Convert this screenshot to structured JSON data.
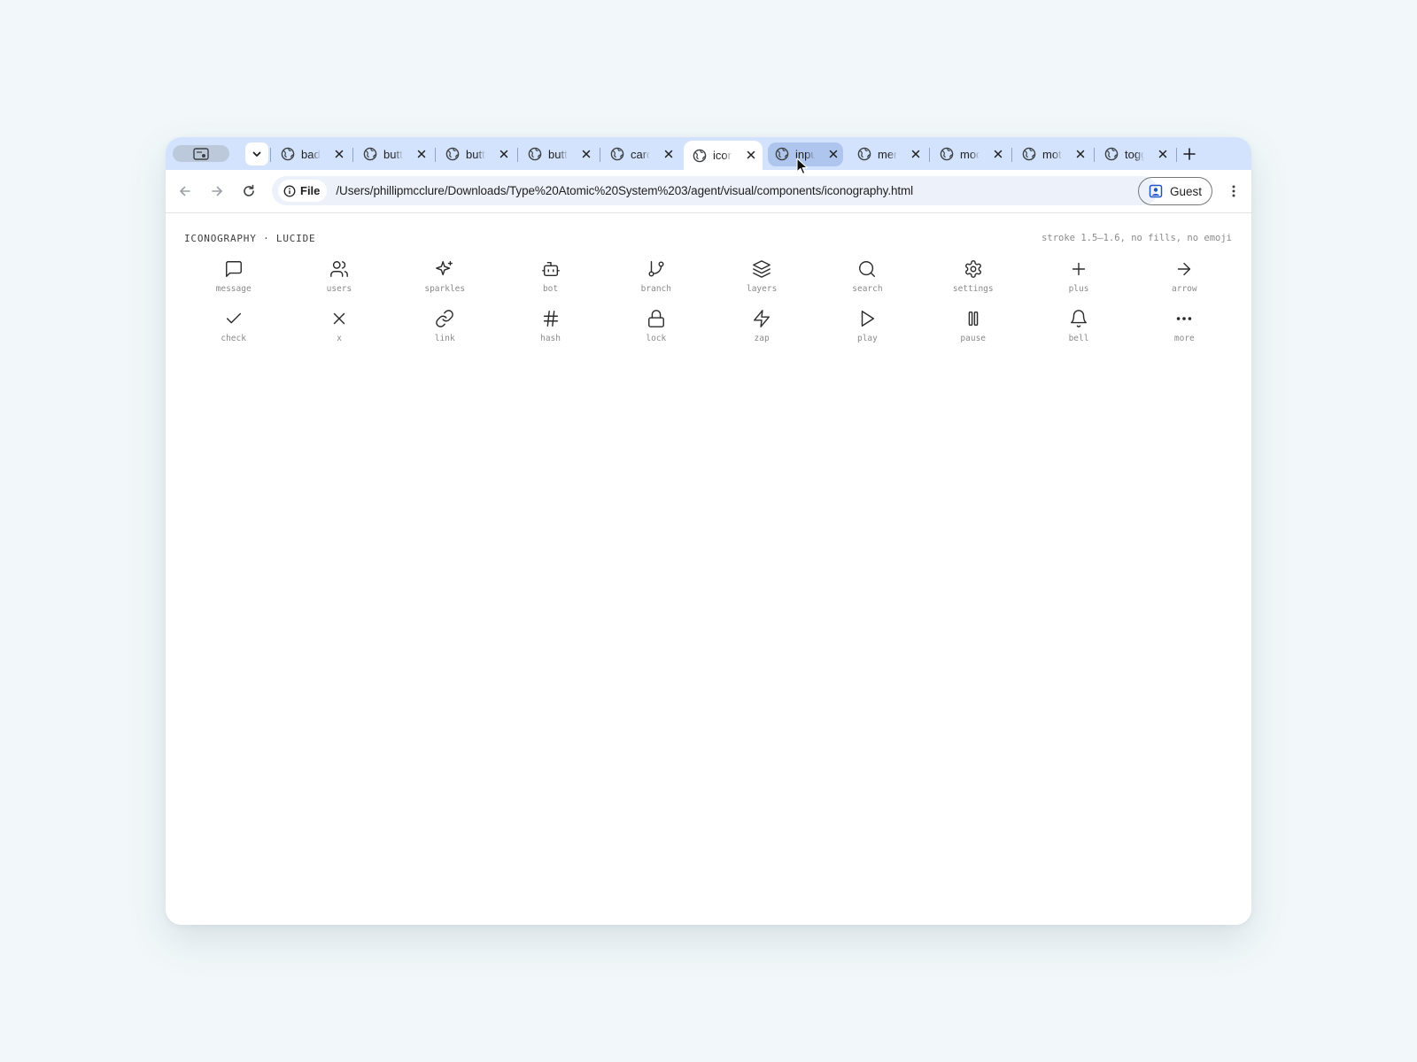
{
  "browser": {
    "tabs": [
      {
        "title": "badges"
      },
      {
        "title": "buttons"
      },
      {
        "title": "buttons"
      },
      {
        "title": "buttons"
      },
      {
        "title": "cards"
      },
      {
        "title": "iconography",
        "active": true
      },
      {
        "title": "inputs",
        "hovered": true
      },
      {
        "title": "menus"
      },
      {
        "title": "modals"
      },
      {
        "title": "motion"
      },
      {
        "title": "toggles"
      }
    ],
    "omnibox": {
      "scheme_chip": "File",
      "url": "/Users/phillipmcclure/Downloads/Type%20Atomic%20System%203/agent/visual/components/iconography.html"
    },
    "profile_label": "Guest"
  },
  "page": {
    "title": "ICONOGRAPHY · LUCIDE",
    "note": "stroke 1.5–1.6, no fills, no emoji",
    "icons": [
      {
        "name": "message",
        "label": "message"
      },
      {
        "name": "users",
        "label": "users"
      },
      {
        "name": "sparkles",
        "label": "sparkles"
      },
      {
        "name": "bot",
        "label": "bot"
      },
      {
        "name": "branch",
        "label": "branch"
      },
      {
        "name": "layers",
        "label": "layers"
      },
      {
        "name": "search",
        "label": "search"
      },
      {
        "name": "settings",
        "label": "settings"
      },
      {
        "name": "plus",
        "label": "plus"
      },
      {
        "name": "arrow",
        "label": "arrow"
      },
      {
        "name": "check",
        "label": "check"
      },
      {
        "name": "x",
        "label": "x"
      },
      {
        "name": "link",
        "label": "link"
      },
      {
        "name": "hash",
        "label": "hash"
      },
      {
        "name": "lock",
        "label": "lock"
      },
      {
        "name": "zap",
        "label": "zap"
      },
      {
        "name": "play",
        "label": "play"
      },
      {
        "name": "pause",
        "label": "pause"
      },
      {
        "name": "bell",
        "label": "bell"
      },
      {
        "name": "more",
        "label": "more"
      }
    ]
  },
  "colors": {
    "background": "#f2f8fa",
    "tabstrip": "#d3e3fd",
    "omnibox": "#edf2fa",
    "icon_stroke": "#2b2b2b",
    "label": "#8a8a8a"
  }
}
